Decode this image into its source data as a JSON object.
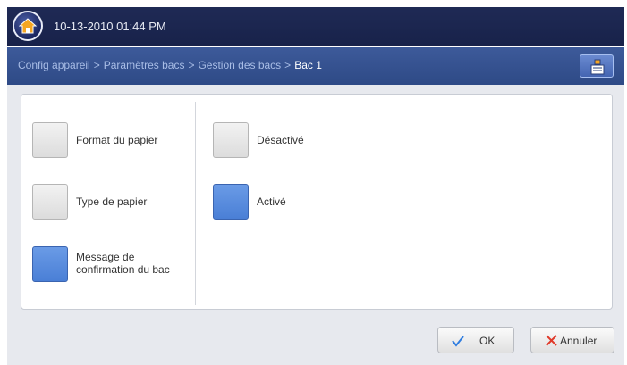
{
  "header": {
    "datetime": "10-13-2010 01:44 PM"
  },
  "breadcrumb": {
    "items": [
      "Config appareil",
      "Paramètres bacs",
      "Gestion des bacs"
    ],
    "current": "Bac 1",
    "separator": ">"
  },
  "menu": {
    "items": [
      {
        "label": "Format du papier",
        "selected": false
      },
      {
        "label": "Type de papier",
        "selected": false
      },
      {
        "label_line1": "Message de",
        "label_line2": "confirmation du bac",
        "selected": true
      }
    ]
  },
  "options": {
    "items": [
      {
        "label": "Désactivé",
        "selected": false
      },
      {
        "label": "Activé",
        "selected": true
      }
    ]
  },
  "footer": {
    "ok_label": "OK",
    "cancel_label": "Annuler"
  },
  "colors": {
    "topbar": "#1f2a55",
    "breadcrumb_bar": "#3d5a9a",
    "selected": "#4a7fd6",
    "ok_check": "#2f7de0",
    "cancel_x": "#e03a2a"
  }
}
